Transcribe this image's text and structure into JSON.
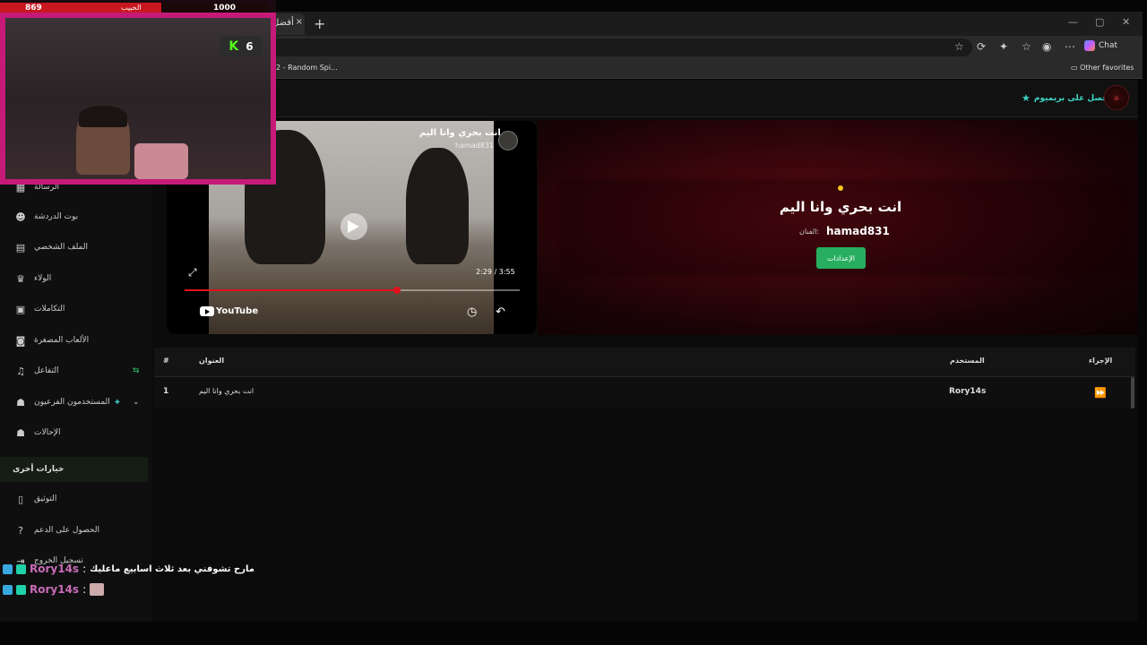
{
  "browser": {
    "tab_title": "أفضل",
    "fav_item": "2 - Random Spi...",
    "other_favorites": "Other favorites",
    "chat_label": "Chat"
  },
  "site": {
    "premium_label": "احصل على بريميوم"
  },
  "sidebar": {
    "items": [
      {
        "label": "الرسالة",
        "icon": "store-icon"
      },
      {
        "label": "بوت الدردشة",
        "icon": "robot-icon"
      },
      {
        "label": "الملف الشخصي",
        "icon": "id-card-icon"
      },
      {
        "label": "الولاء",
        "icon": "trophy-icon"
      },
      {
        "label": "التكاملات",
        "icon": "plug-icon"
      },
      {
        "label": "الألعاب المصغرة",
        "icon": "gamepad-icon"
      },
      {
        "label": "التفاعل",
        "icon": "music-icon"
      },
      {
        "label": "المستخدمون الفرعيون",
        "icon": "users-icon"
      },
      {
        "label": "الإحالات",
        "icon": "user-group-icon"
      }
    ],
    "section_label": "خيارات أخرى",
    "other_items": [
      {
        "label": "التوثيق",
        "icon": "scroll-icon"
      },
      {
        "label": "الحصول على الدعم",
        "icon": "question-icon"
      },
      {
        "label": "تسجيل الخروج",
        "icon": "logout-icon"
      }
    ]
  },
  "video": {
    "title": "انت بحري وانا اليم",
    "channel": "hamad831",
    "time": "2:29 / 3:55",
    "progress": 0.634,
    "brand": "YouTube"
  },
  "hero": {
    "title": "انت بحري وانا اليم",
    "artist": "hamad831",
    "artist_label": "الفنان:",
    "settings_label": "الإعدادات"
  },
  "table": {
    "headers": {
      "num": "#",
      "title": "العنوان",
      "user": "المستخدم",
      "action": "الإجراء"
    },
    "rows": [
      {
        "num": "1",
        "title": "انت بحري وانا اليم",
        "user": "Rory14s"
      }
    ]
  },
  "stream": {
    "left_count": "869",
    "right_count": "1000",
    "name": "الحبيب",
    "kick_count": "6"
  },
  "chat": [
    {
      "user": "Rory14s",
      "message": "مارح تشوفني بعد ثلاث اسابيع ماعليك"
    },
    {
      "user": "Rory14s",
      "message": ""
    }
  ]
}
